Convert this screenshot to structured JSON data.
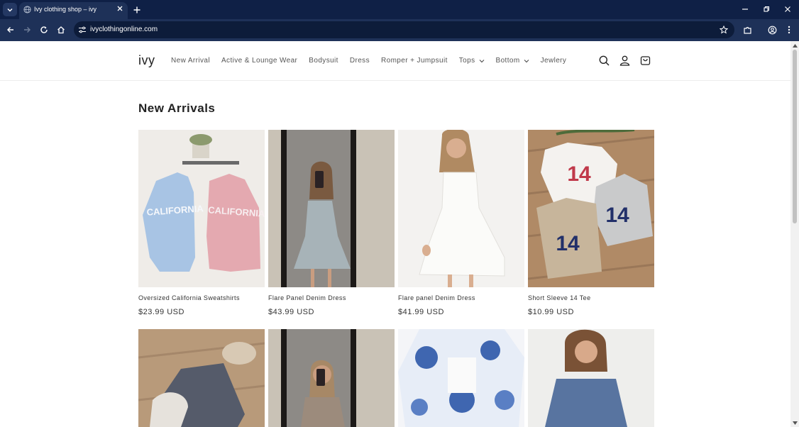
{
  "browser": {
    "tab_title": "Ivy clothing shop – ivy",
    "url": "ivyclothingonline.com"
  },
  "header": {
    "logo": "ivy",
    "nav": [
      {
        "label": "New Arrival"
      },
      {
        "label": "Active & Lounge Wear"
      },
      {
        "label": "Bodysuit"
      },
      {
        "label": "Dress"
      },
      {
        "label": "Romper + Jumpsuit"
      },
      {
        "label": "Tops",
        "dropdown": true
      },
      {
        "label": "Bottom",
        "dropdown": true
      },
      {
        "label": "Jewlery"
      }
    ],
    "icons": [
      "search-icon",
      "account-icon",
      "cart-icon"
    ]
  },
  "main": {
    "section_title": "New Arrivals",
    "products": [
      {
        "title": "Oversized California Sweatshirts",
        "price": "$23.99 USD"
      },
      {
        "title": "Flare Panel Denim Dress",
        "price": "$43.99 USD"
      },
      {
        "title": "Flare panel Denim Dress",
        "price": "$41.99 USD"
      },
      {
        "title": "Short Sleeve 14 Tee",
        "price": "$10.99 USD"
      }
    ],
    "images_row1": [
      "CALIFORNIA",
      "CALIFORNIA",
      "14",
      "14",
      "14"
    ]
  },
  "colors": {
    "tab_strip": "#0f2046",
    "toolbar": "#1e3158",
    "text": "#222222"
  }
}
